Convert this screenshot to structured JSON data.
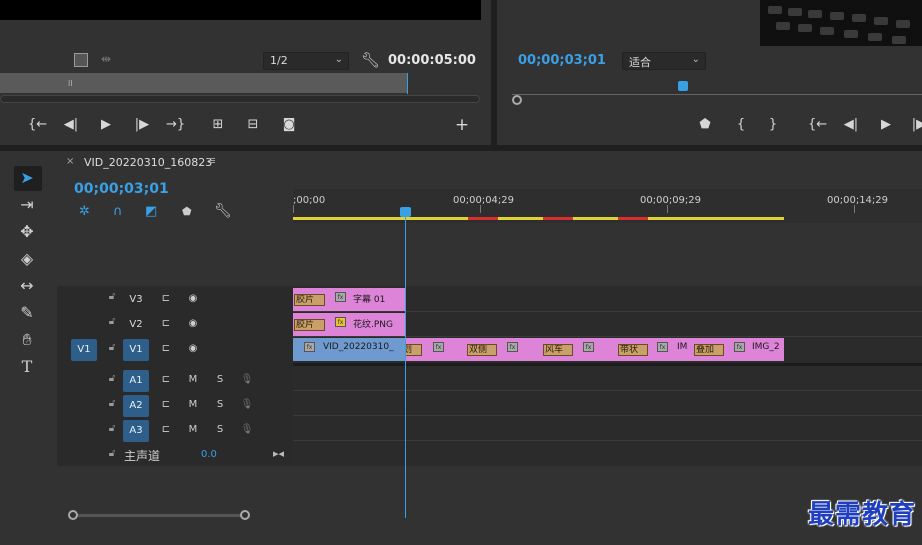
{
  "source_monitor": {
    "zoom_select": "1/2",
    "duration": "00:00:05:00",
    "controls": [
      "mark-in",
      "step-back",
      "play",
      "step-forward",
      "mark-out",
      "insert",
      "overwrite",
      "export-frame",
      "add"
    ]
  },
  "program_monitor": {
    "timecode": "00;00;03;01",
    "fit_select": "适合"
  },
  "timeline": {
    "tab_close": "×",
    "sequence_name": "VID_20220310_160823",
    "tab_menu": "≡",
    "timecode": "00;00;03;01",
    "ruler_labels": [
      ";00;00",
      "00;00;04;29",
      "00;00;09;29",
      "00;00;14;29"
    ],
    "tracks": {
      "V3": "V3",
      "V2": "V2",
      "V1": "V1",
      "V1_source": "V1",
      "A1": "A1",
      "A2": "A2",
      "A3": "A3",
      "mute": "M",
      "solo": "S",
      "master_label": "主声道",
      "master_value": "0.0"
    },
    "clips": {
      "v3_trans": "胶片",
      "v3_title": "字幕 01",
      "v2_trans": "胶片",
      "v2_title": "花纹.PNG",
      "v1_main": "VID_20220310_",
      "v1_t1": "圆划",
      "v1_t2": "双侧",
      "v1_t3": "风车",
      "v1_t4": "带状",
      "v1_im": "IM",
      "v1_t5": "叠加",
      "v1_img2": "IMG_2"
    }
  },
  "watermark": "最需教育",
  "colors": {
    "accent": "#3aa0e6",
    "clip_pink": "#dd83d8",
    "clip_blue": "#6e9ad0",
    "panel": "#323232"
  }
}
